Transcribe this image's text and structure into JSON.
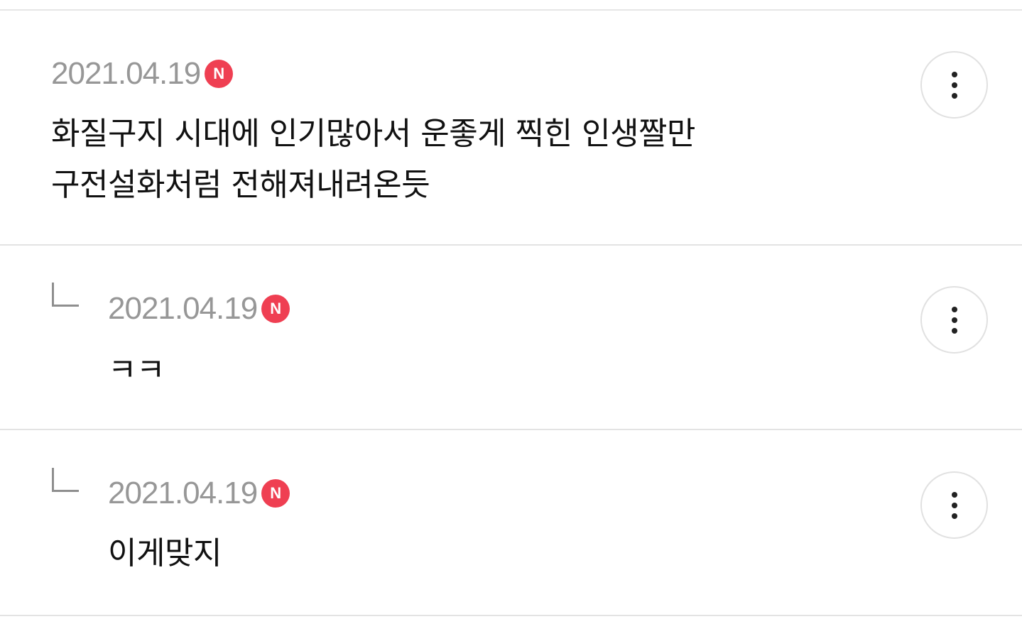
{
  "comments": [
    {
      "date": "2021.04.19",
      "badge": "N",
      "text": "화질구지 시대에 인기많아서 운좋게 찍힌 인생짤만\n구전설화처럼 전해져내려온듯",
      "is_reply": false,
      "more_icon": "more-vertical-icon"
    },
    {
      "date": "2021.04.19",
      "badge": "N",
      "text": "ㅋㅋ",
      "is_reply": true,
      "more_icon": "more-vertical-icon"
    },
    {
      "date": "2021.04.19",
      "badge": "N",
      "text": "이게맞지",
      "is_reply": true,
      "more_icon": "more-vertical-icon"
    }
  ],
  "colors": {
    "badge": "#ef3f52",
    "date": "#979797",
    "text": "#111111",
    "divider": "#e3e3e3"
  }
}
